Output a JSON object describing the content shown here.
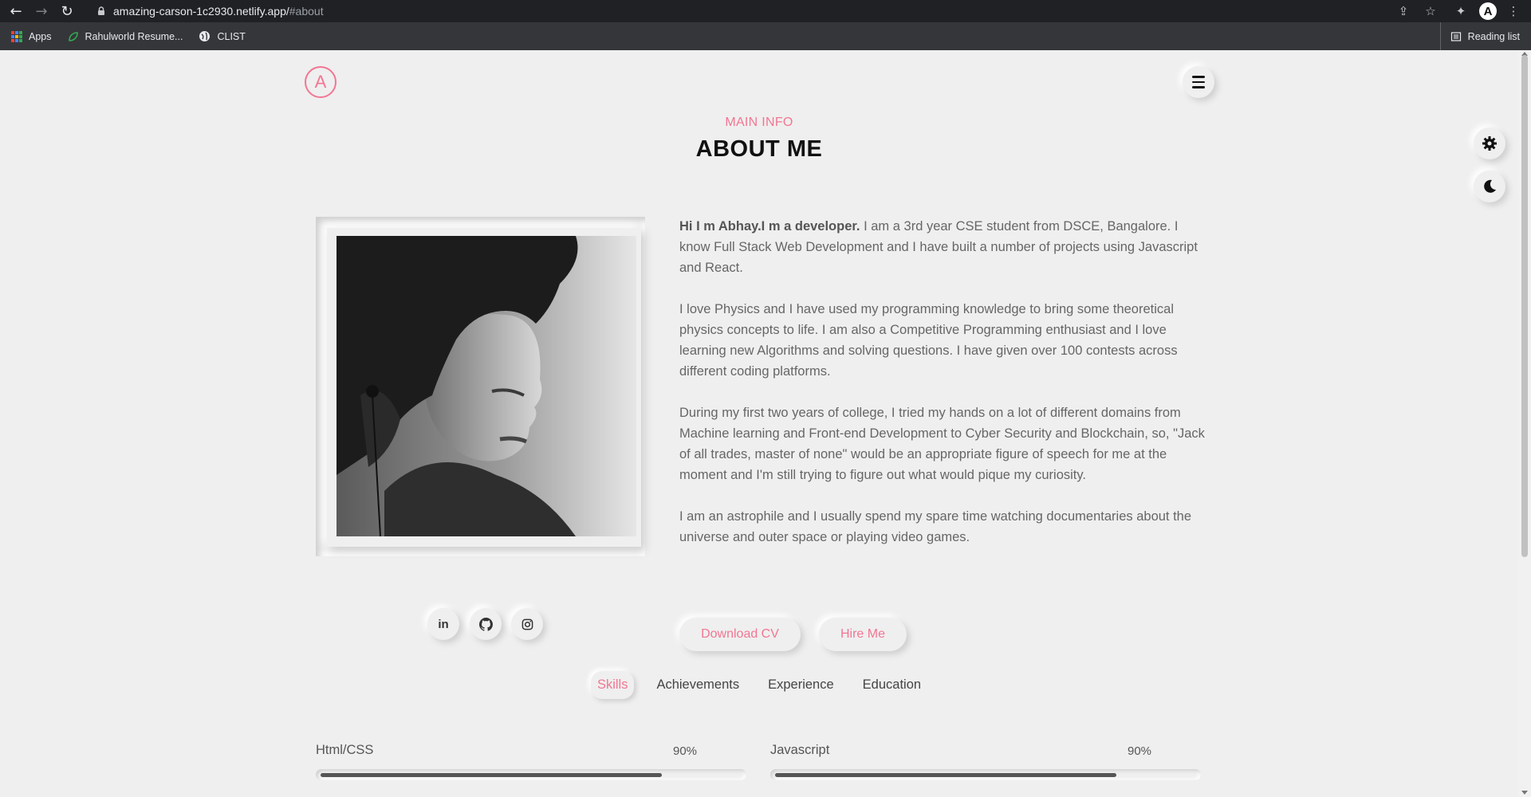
{
  "browser": {
    "url_host": "amazing-carson-1c2930.netlify.app/",
    "url_path": "#about",
    "profile_initial": "A",
    "bookmarks": [
      {
        "label": "Apps",
        "icon": "apps-grid-icon"
      },
      {
        "label": "Rahulworld Resume...",
        "icon": "leaf-icon"
      },
      {
        "label": "CLIST",
        "icon": "globe-icon"
      }
    ],
    "reading_list": "Reading list"
  },
  "site": {
    "logo_letter": "A",
    "accent_color": "#f27693"
  },
  "about": {
    "subtitle": "MAIN INFO",
    "title": "ABOUT ME",
    "intro_bold": "Hi I m Abhay.I m a developer.",
    "paragraph1": " I am a 3rd year CSE student from DSCE, Bangalore. I know Full Stack Web Development and I have built a number of projects using Javascript and React.",
    "paragraph2": "I love Physics and I have used my programming knowledge to bring some theoretical physics concepts to life. I am also a Competitive Programming enthusiast and I love learning new Algorithms and solving questions. I have given over 100 contests across different coding platforms.",
    "paragraph3": "During my first two years of college, I tried my hands on a lot of different domains from Machine learning and Front-end Development to Cyber Security and Blockchain, so, \"Jack of all trades, master of none\" would be an appropriate figure of speech for me at the moment and I'm still trying to figure out what would pique my curiosity.",
    "paragraph4": "I am an astrophile and I usually spend my spare time watching documentaries about the universe and outer space or playing video games.",
    "download_cv": "Download CV",
    "hire_me": "Hire Me",
    "social": [
      {
        "name": "linkedin",
        "glyph": "in"
      },
      {
        "name": "github",
        "glyph": "gh"
      },
      {
        "name": "instagram",
        "glyph": "ig"
      }
    ]
  },
  "tabs": [
    {
      "label": "Skills",
      "active": true
    },
    {
      "label": "Achievements",
      "active": false
    },
    {
      "label": "Experience",
      "active": false
    },
    {
      "label": "Education",
      "active": false
    }
  ],
  "skills": [
    {
      "label": "Html/CSS",
      "percent_text": "90%",
      "percent": 90
    },
    {
      "label": "Javascript",
      "percent_text": "90%",
      "percent": 90
    }
  ]
}
